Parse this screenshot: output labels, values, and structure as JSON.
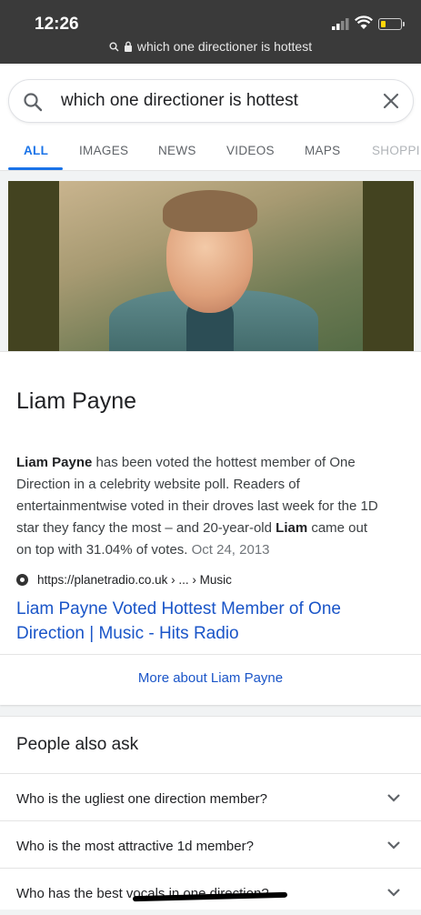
{
  "status": {
    "time": "12:26",
    "url": "which one directioner is hottest"
  },
  "search": {
    "query": "which one directioner is hottest"
  },
  "tabs": [
    {
      "label": "ALL"
    },
    {
      "label": "IMAGES"
    },
    {
      "label": "NEWS"
    },
    {
      "label": "VIDEOS"
    },
    {
      "label": "MAPS"
    },
    {
      "label": "SHOPPI"
    }
  ],
  "card": {
    "entity_title": "Liam Payne",
    "snippet": {
      "bold1": "Liam Payne",
      "text1": " has been voted the hottest member of One Direction in a celebrity website poll. Readers of entertainmentwise voted in their droves last week for the 1D star they fancy the most – and 20-year-old ",
      "bold2": "Liam",
      "text2": " came out on top with 31.04% of votes.",
      "date": "Oct 24, 2013"
    },
    "source": "https://planetradio.co.uk › ... › Music",
    "result_title": "Liam Payne Voted Hottest Member of One Direction | Music - Hits Radio",
    "more": "More about Liam Payne"
  },
  "people_also_ask": {
    "title": "People also ask",
    "questions": [
      "Who is the ugliest one direction member?",
      "Who is the most attractive 1d member?",
      "Who has the best vocals in one direction?"
    ]
  },
  "colors": {
    "accent": "#1a73e8",
    "link": "#1a55c8",
    "status_bar": "#3a3a3a"
  }
}
